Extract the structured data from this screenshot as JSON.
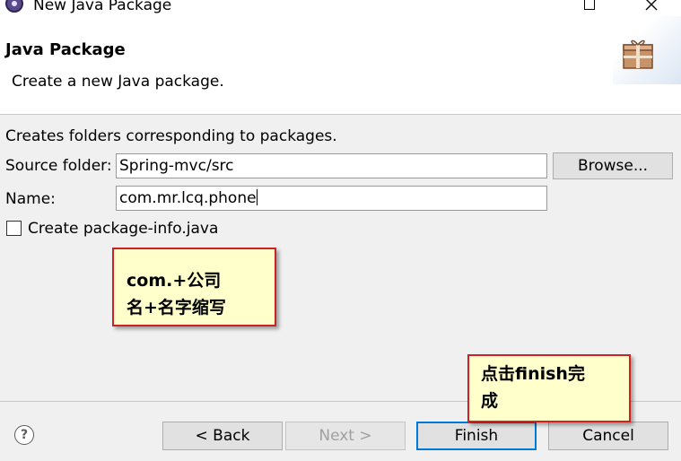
{
  "window": {
    "title": "New Java Package",
    "maximize_glyph": "□",
    "close_glyph": "✕"
  },
  "header": {
    "title": "Java Package",
    "description": "Create a new Java package."
  },
  "form": {
    "intro": "Creates folders corresponding to packages.",
    "source_folder_label": "Source folder:",
    "source_folder_value": "Spring-mvc/src",
    "browse_label": "Browse...",
    "name_label": "Name:",
    "name_value": "com.mr.lcq.phone",
    "package_info_label": "Create package-info.java",
    "package_info_checked": false
  },
  "annotations": {
    "note1_line1": "com.+公司",
    "note1_line2": "名+名字缩写",
    "note2_line1": "点击finish完",
    "note2_line2": "成"
  },
  "footer": {
    "help_glyph": "?",
    "back_label": "< Back",
    "next_label": "Next >",
    "finish_label": "Finish",
    "cancel_label": "Cancel"
  },
  "colors": {
    "accent": "#0078d7",
    "note_border": "#cc2222",
    "note_fill": "#ffffcc"
  }
}
